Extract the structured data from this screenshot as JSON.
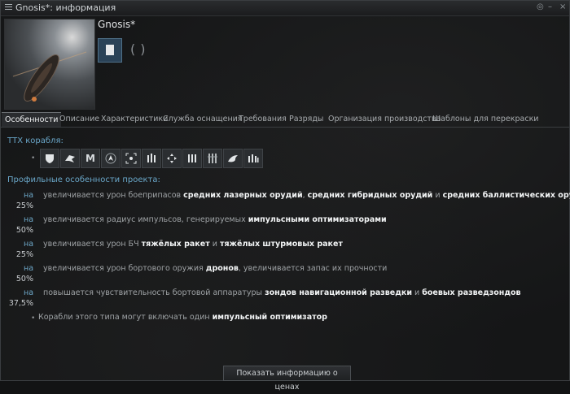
{
  "window": {
    "title": "Gnosis*: информация",
    "ship_name": "Gnosis*"
  },
  "tabs": [
    {
      "label": "Особенности",
      "active": true
    },
    {
      "label": "Описание"
    },
    {
      "label": "Характеристики"
    },
    {
      "label": "Служба оснащения"
    },
    {
      "label": "Требования"
    },
    {
      "label": "Разряды"
    },
    {
      "label": "Организация производства"
    },
    {
      "label": "Шаблоны для перекраски"
    }
  ],
  "specs": {
    "heading": "ТТХ корабля:",
    "icons": [
      "shield-icon",
      "drone-icon",
      "m-letter-icon",
      "navigation-icon",
      "target-icon",
      "turret-icon",
      "expand-icon",
      "launcher-icon",
      "missile-rack-icon",
      "bird-icon",
      "fitting-icon"
    ]
  },
  "bonuses": {
    "heading": "Профильные особенности проекта:",
    "items": [
      {
        "na": "на",
        "pct": "25%",
        "parts": [
          {
            "t": "увеличивается урон боеприпасов ",
            "b": false
          },
          {
            "t": "средних лазерных орудий",
            "b": true
          },
          {
            "t": ", ",
            "b": false
          },
          {
            "t": "средних гибридных орудий",
            "b": true
          },
          {
            "t": " и ",
            "b": false
          },
          {
            "t": "средних баллистических орудий",
            "b": true
          }
        ]
      },
      {
        "na": "на",
        "pct": "50%",
        "parts": [
          {
            "t": "увеличивается радиус импульсов, генерируемых ",
            "b": false
          },
          {
            "t": "импульсными оптимизаторами",
            "b": true
          }
        ]
      },
      {
        "na": "на",
        "pct": "25%",
        "parts": [
          {
            "t": "увеличивается урон БЧ ",
            "b": false
          },
          {
            "t": "тяжёлых ракет",
            "b": true
          },
          {
            "t": " и ",
            "b": false
          },
          {
            "t": "тяжёлых штурмовых ракет",
            "b": true
          }
        ]
      },
      {
        "na": "на",
        "pct": "50%",
        "parts": [
          {
            "t": "увеличивается урон бортового оружия ",
            "b": false
          },
          {
            "t": "дронов",
            "b": true
          },
          {
            "t": ", увеличивается запас их прочности",
            "b": false
          }
        ]
      },
      {
        "na": "на",
        "pct": "37,5%",
        "parts": [
          {
            "t": "повышается чувствительность бортовой аппаратуры ",
            "b": false
          },
          {
            "t": "зондов навигационной разведки",
            "b": true
          },
          {
            "t": " и ",
            "b": false
          },
          {
            "t": "боевых разведзондов",
            "b": true
          }
        ]
      }
    ],
    "note_parts": [
      {
        "t": "Корабли этого типа могут включать один ",
        "b": false
      },
      {
        "t": "импульсный оптимизатор",
        "b": true
      }
    ]
  },
  "footer": {
    "price_button": "Показать информацию о ценах"
  }
}
